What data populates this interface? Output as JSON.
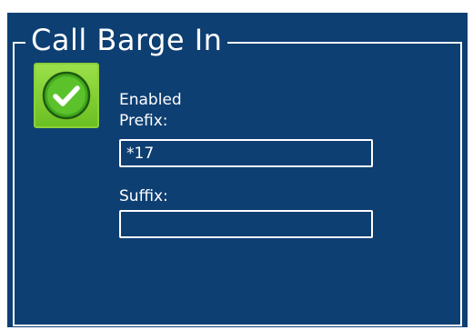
{
  "section": {
    "title": "Call Barge In"
  },
  "enabled": {
    "label": "Enabled",
    "checked": true
  },
  "prefix": {
    "label": "Prefix:",
    "value": "*17"
  },
  "suffix": {
    "label": "Suffix:",
    "value": ""
  },
  "colors": {
    "panel_background": "#0e3f73",
    "toggle_green": "#7ccc2f",
    "text": "#ffffff"
  },
  "icons": {
    "toggle": "checkmark-icon"
  }
}
